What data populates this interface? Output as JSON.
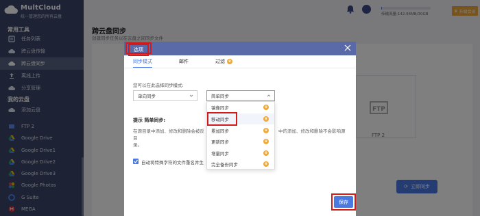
{
  "sidebar": {
    "brand": "MultCloud",
    "slogan": "统一管理您的所有云盘",
    "section_tools": "常用工具",
    "section_clouds": "我的云盘",
    "tools": [
      {
        "label": "任务列表",
        "icon": "list-icon"
      },
      {
        "label": "跨云盘传输",
        "icon": "cloud-transfer-icon"
      },
      {
        "label": "跨云盘同步",
        "icon": "cloud-sync-icon"
      },
      {
        "label": "离线上传",
        "icon": "upload-icon"
      },
      {
        "label": "分享管理",
        "icon": "share-icon"
      }
    ],
    "clouds": [
      {
        "label": "添加云盘",
        "icon": "add-cloud-icon"
      },
      {
        "label": "FTP 2",
        "icon": "ftp-icon"
      },
      {
        "label": "Google Drive",
        "icon": "google-drive-icon"
      },
      {
        "label": "Google Drive1",
        "icon": "google-drive-icon"
      },
      {
        "label": "Google Drive2",
        "icon": "google-drive-icon"
      },
      {
        "label": "Google Drive3",
        "icon": "google-drive-icon"
      },
      {
        "label": "Google Photos",
        "icon": "google-photos-icon"
      },
      {
        "label": "G Suite",
        "icon": "g-suite-icon"
      },
      {
        "label": "MEGA",
        "icon": "mega-icon"
      }
    ]
  },
  "header": {
    "traffic_text": "传输流量:142.94MB/30GB",
    "upgrade_label": "升级会员"
  },
  "page": {
    "title": "跨云盘同步",
    "desc": "创建同步任务以在云盘之间同步文件"
  },
  "background": {
    "ftp_label": "FTP 2",
    "sync_now_label": "立即同步"
  },
  "modal": {
    "title": "选项",
    "tabs": [
      {
        "label": "同步模式"
      },
      {
        "label": "邮件"
      },
      {
        "label": "过滤"
      }
    ],
    "mode_prompt": "您可以在此选择同步模式:",
    "select_left": "单向同步",
    "select_right": "简单同步",
    "tip_title": "提示  简单同步:",
    "tip_text_a": "在源目录中添加、修改和删除会被反",
    "tip_text_b": "中的添加、修改和删除不会影响源目",
    "tip_text_c": "录。",
    "checkbox_label": "自动将特殊字符的文件重名并生",
    "save_label": "保存"
  },
  "dropdown": {
    "options": [
      {
        "label": "镜像同步",
        "premium": true
      },
      {
        "label": "移动同步",
        "premium": true
      },
      {
        "label": "累加同步",
        "premium": true
      },
      {
        "label": "更新同步",
        "premium": true
      },
      {
        "label": "增量同步",
        "premium": true
      },
      {
        "label": "完全备份同步",
        "premium": true
      }
    ],
    "highlighted_index": 1,
    "premium_glyph": "♛"
  },
  "colors": {
    "sidebar_bg": "#3b4568",
    "accent": "#4a79e4",
    "highlight_frame": "#d11b1b",
    "premium": "#f0a93a",
    "modal_header": "#5a6aa8"
  }
}
